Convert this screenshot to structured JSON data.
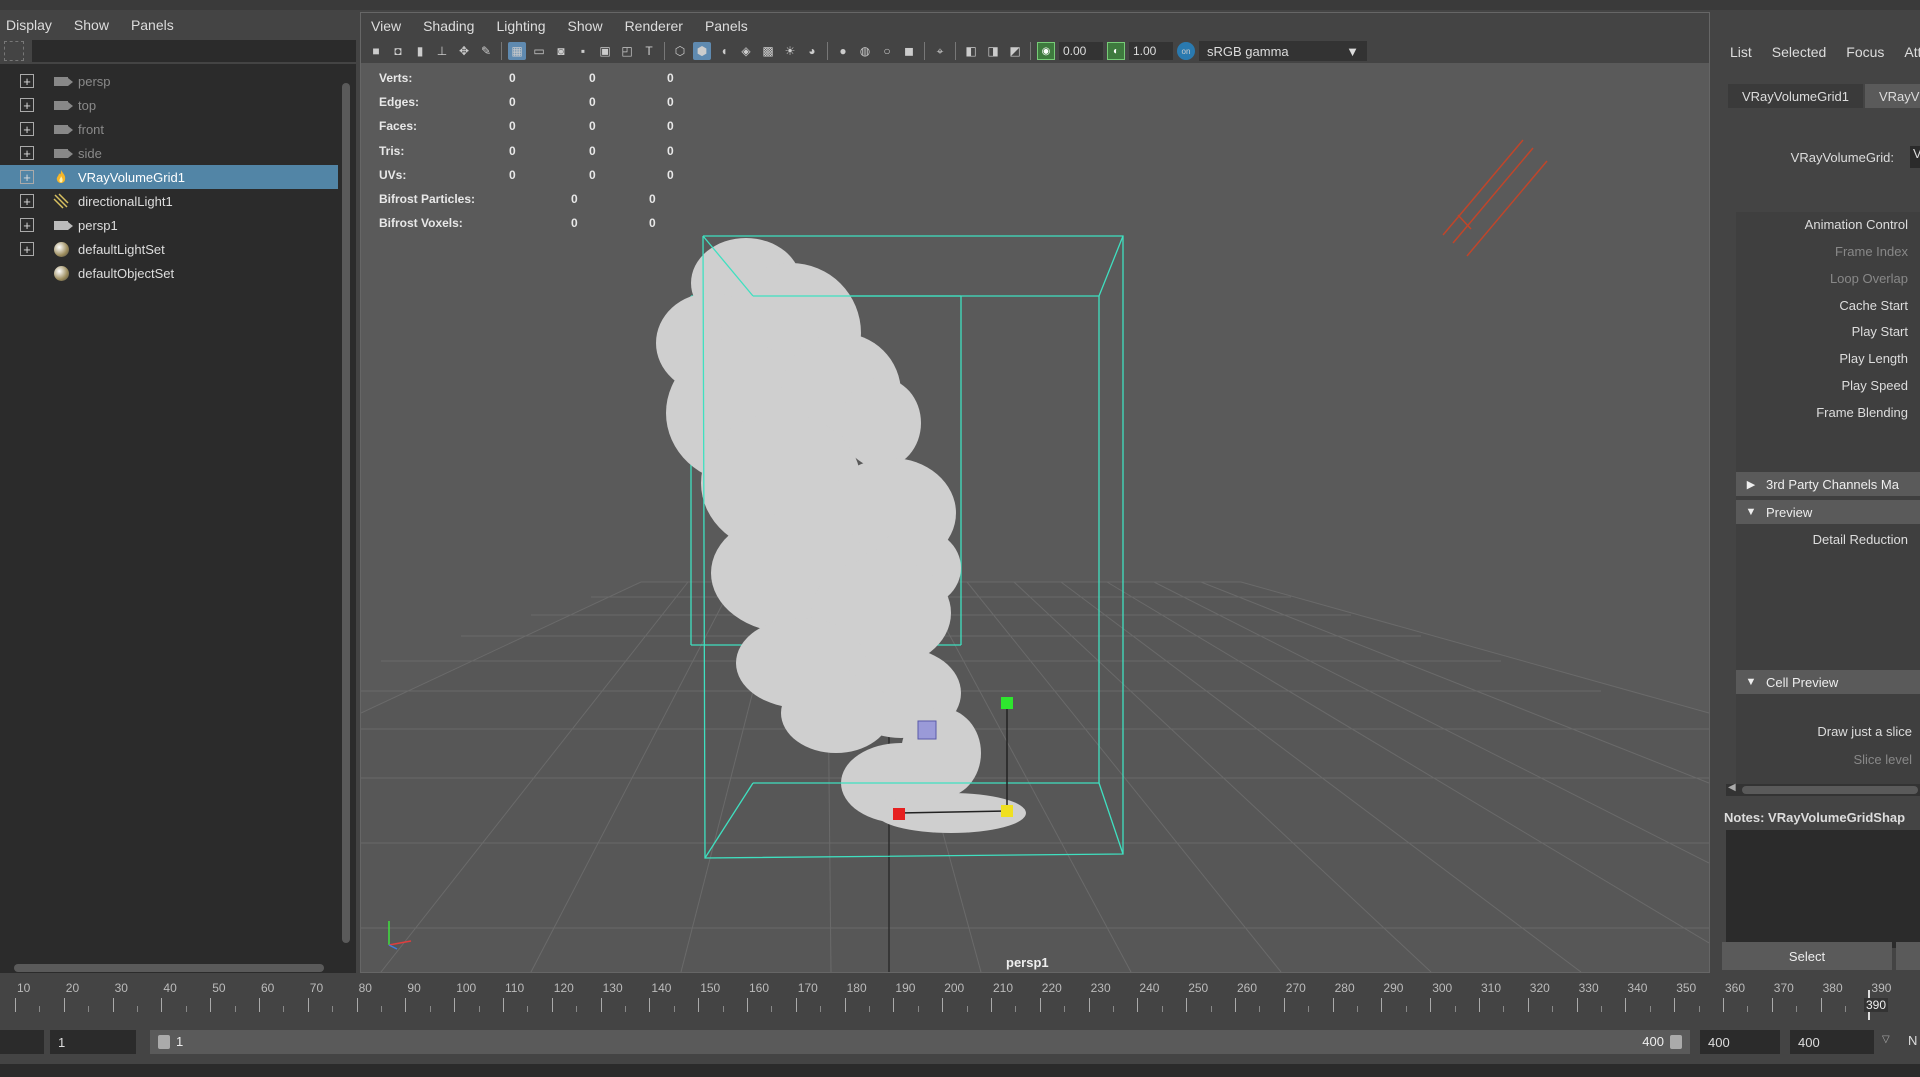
{
  "outliner": {
    "menu": [
      "Display",
      "Show",
      "Panels"
    ],
    "search_placeholder": "",
    "items": [
      {
        "label": "persp",
        "icon": "camera-icon",
        "dim": true
      },
      {
        "label": "top",
        "icon": "camera-icon",
        "dim": true
      },
      {
        "label": "front",
        "icon": "camera-icon",
        "dim": true
      },
      {
        "label": "side",
        "icon": "camera-icon",
        "dim": true
      },
      {
        "label": "VRayVolumeGrid1",
        "icon": "fire-icon",
        "selected": true
      },
      {
        "label": "directionalLight1",
        "icon": "directional-light-icon"
      },
      {
        "label": "persp1",
        "icon": "camera-icon"
      },
      {
        "label": "defaultLightSet",
        "icon": "set-icon"
      },
      {
        "label": "defaultObjectSet",
        "icon": "set-icon",
        "no_expand": true
      }
    ]
  },
  "viewport": {
    "menu": [
      "View",
      "Shading",
      "Lighting",
      "Show",
      "Renderer",
      "Panels"
    ],
    "exposure": "0.00",
    "gamma": "1.00",
    "color_management": "sRGB gamma",
    "camera_label": "persp1",
    "hud": [
      {
        "label": "Verts:",
        "values": [
          "0",
          "0",
          "0"
        ]
      },
      {
        "label": "Edges:",
        "values": [
          "0",
          "0",
          "0"
        ]
      },
      {
        "label": "Faces:",
        "values": [
          "0",
          "0",
          "0"
        ]
      },
      {
        "label": "Tris:",
        "values": [
          "0",
          "0",
          "0"
        ]
      },
      {
        "label": "UVs:",
        "values": [
          "0",
          "0",
          "0"
        ]
      },
      {
        "label": "Bifrost Particles:",
        "values": [
          "0",
          "0"
        ]
      },
      {
        "label": "Bifrost Voxels:",
        "values": [
          "0",
          "0"
        ]
      }
    ]
  },
  "attribute_editor": {
    "tabs": [
      "List",
      "Selected",
      "Focus",
      "Attri"
    ],
    "node_tabs": [
      "VRayVolumeGrid1",
      "VRayV"
    ],
    "node_label": "VRayVolumeGrid:",
    "node_value": "V",
    "rows": [
      {
        "label": "Animation Control",
        "dim": false
      },
      {
        "label": "Frame Index",
        "dim": true
      },
      {
        "label": "Loop Overlap",
        "dim": true
      },
      {
        "label": "Cache Start",
        "dim": false
      },
      {
        "label": "Play Start",
        "dim": false
      },
      {
        "label": "Play Length",
        "dim": false
      },
      {
        "label": "Play Speed",
        "dim": false
      },
      {
        "label": "Frame Blending",
        "dim": false
      }
    ],
    "sections": {
      "third_party": "3rd Party Channels Ma",
      "preview": "Preview",
      "detail_reduction": "Detail Reduction",
      "cell_preview": "Cell Preview",
      "draw_slice": "Draw just a slice",
      "slice_level": "Slice level"
    },
    "notes_label": "Notes:  VRayVolumeGridShap",
    "select_button": "Select"
  },
  "timeline": {
    "labels": [
      "10",
      "20",
      "30",
      "40",
      "50",
      "60",
      "70",
      "80",
      "90",
      "100",
      "110",
      "120",
      "130",
      "140",
      "150",
      "160",
      "170",
      "180",
      "190",
      "200",
      "210",
      "220",
      "230",
      "240",
      "250",
      "260",
      "270",
      "280",
      "290",
      "300",
      "310",
      "320",
      "330",
      "340",
      "350",
      "360",
      "370",
      "380",
      "390"
    ],
    "current_frame": "390"
  },
  "range": {
    "start": "1",
    "slider_start": "1",
    "slider_end": "400",
    "end": "400",
    "anim_end": "400",
    "extra": "N"
  },
  "colors": {
    "selection": "#5285a6",
    "bbox": "#3fe0c0",
    "grid": "#6a6a6a"
  }
}
